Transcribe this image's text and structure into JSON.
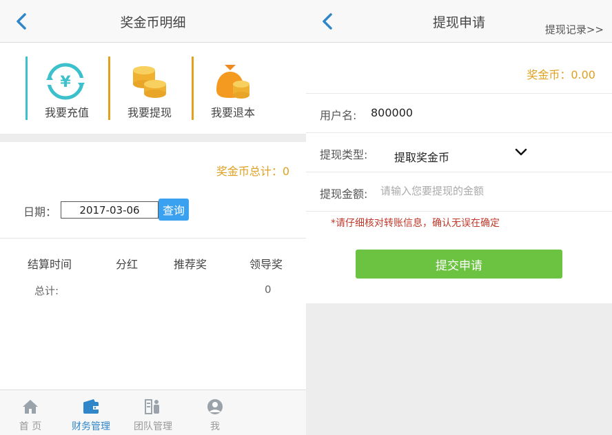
{
  "left": {
    "title": "奖金币明细",
    "actions": [
      {
        "label": "我要充值"
      },
      {
        "label": "我要提现"
      },
      {
        "label": "我要退本"
      }
    ],
    "total_label": "奖金币总计：0",
    "date_label": "日期：",
    "date_value": "2017-03-06",
    "query_label": "查询",
    "table": {
      "headers": [
        "结算时间",
        "分红",
        "推荐奖",
        "领导奖"
      ],
      "summary_label": "总计:",
      "summary_value": "0"
    },
    "tabs": [
      {
        "label": "首 页",
        "icon": "home-icon"
      },
      {
        "label": "财务管理",
        "icon": "wallet-icon"
      },
      {
        "label": "团队管理",
        "icon": "team-icon"
      },
      {
        "label": "我",
        "icon": "user-icon"
      }
    ],
    "active_tab": 1
  },
  "right": {
    "title": "提现申请",
    "records_link": "提现记录>>",
    "balance": "奖金币：0.00",
    "username_label": "用户名:",
    "username_value": "800000",
    "type_label": "提现类型:",
    "type_value": "提取奖金币",
    "amount_label": "提现金额:",
    "amount_placeholder": "请输入您要提现的金额",
    "warning": "*请仔细核对转账信息，确认无误在确定",
    "submit_label": "提交申请"
  },
  "colors": {
    "accent_blue": "#2f86c8",
    "gold": "#e0a020",
    "teal": "#3cc0cc",
    "green": "#6cc241",
    "warn_red": "#c0392b"
  }
}
